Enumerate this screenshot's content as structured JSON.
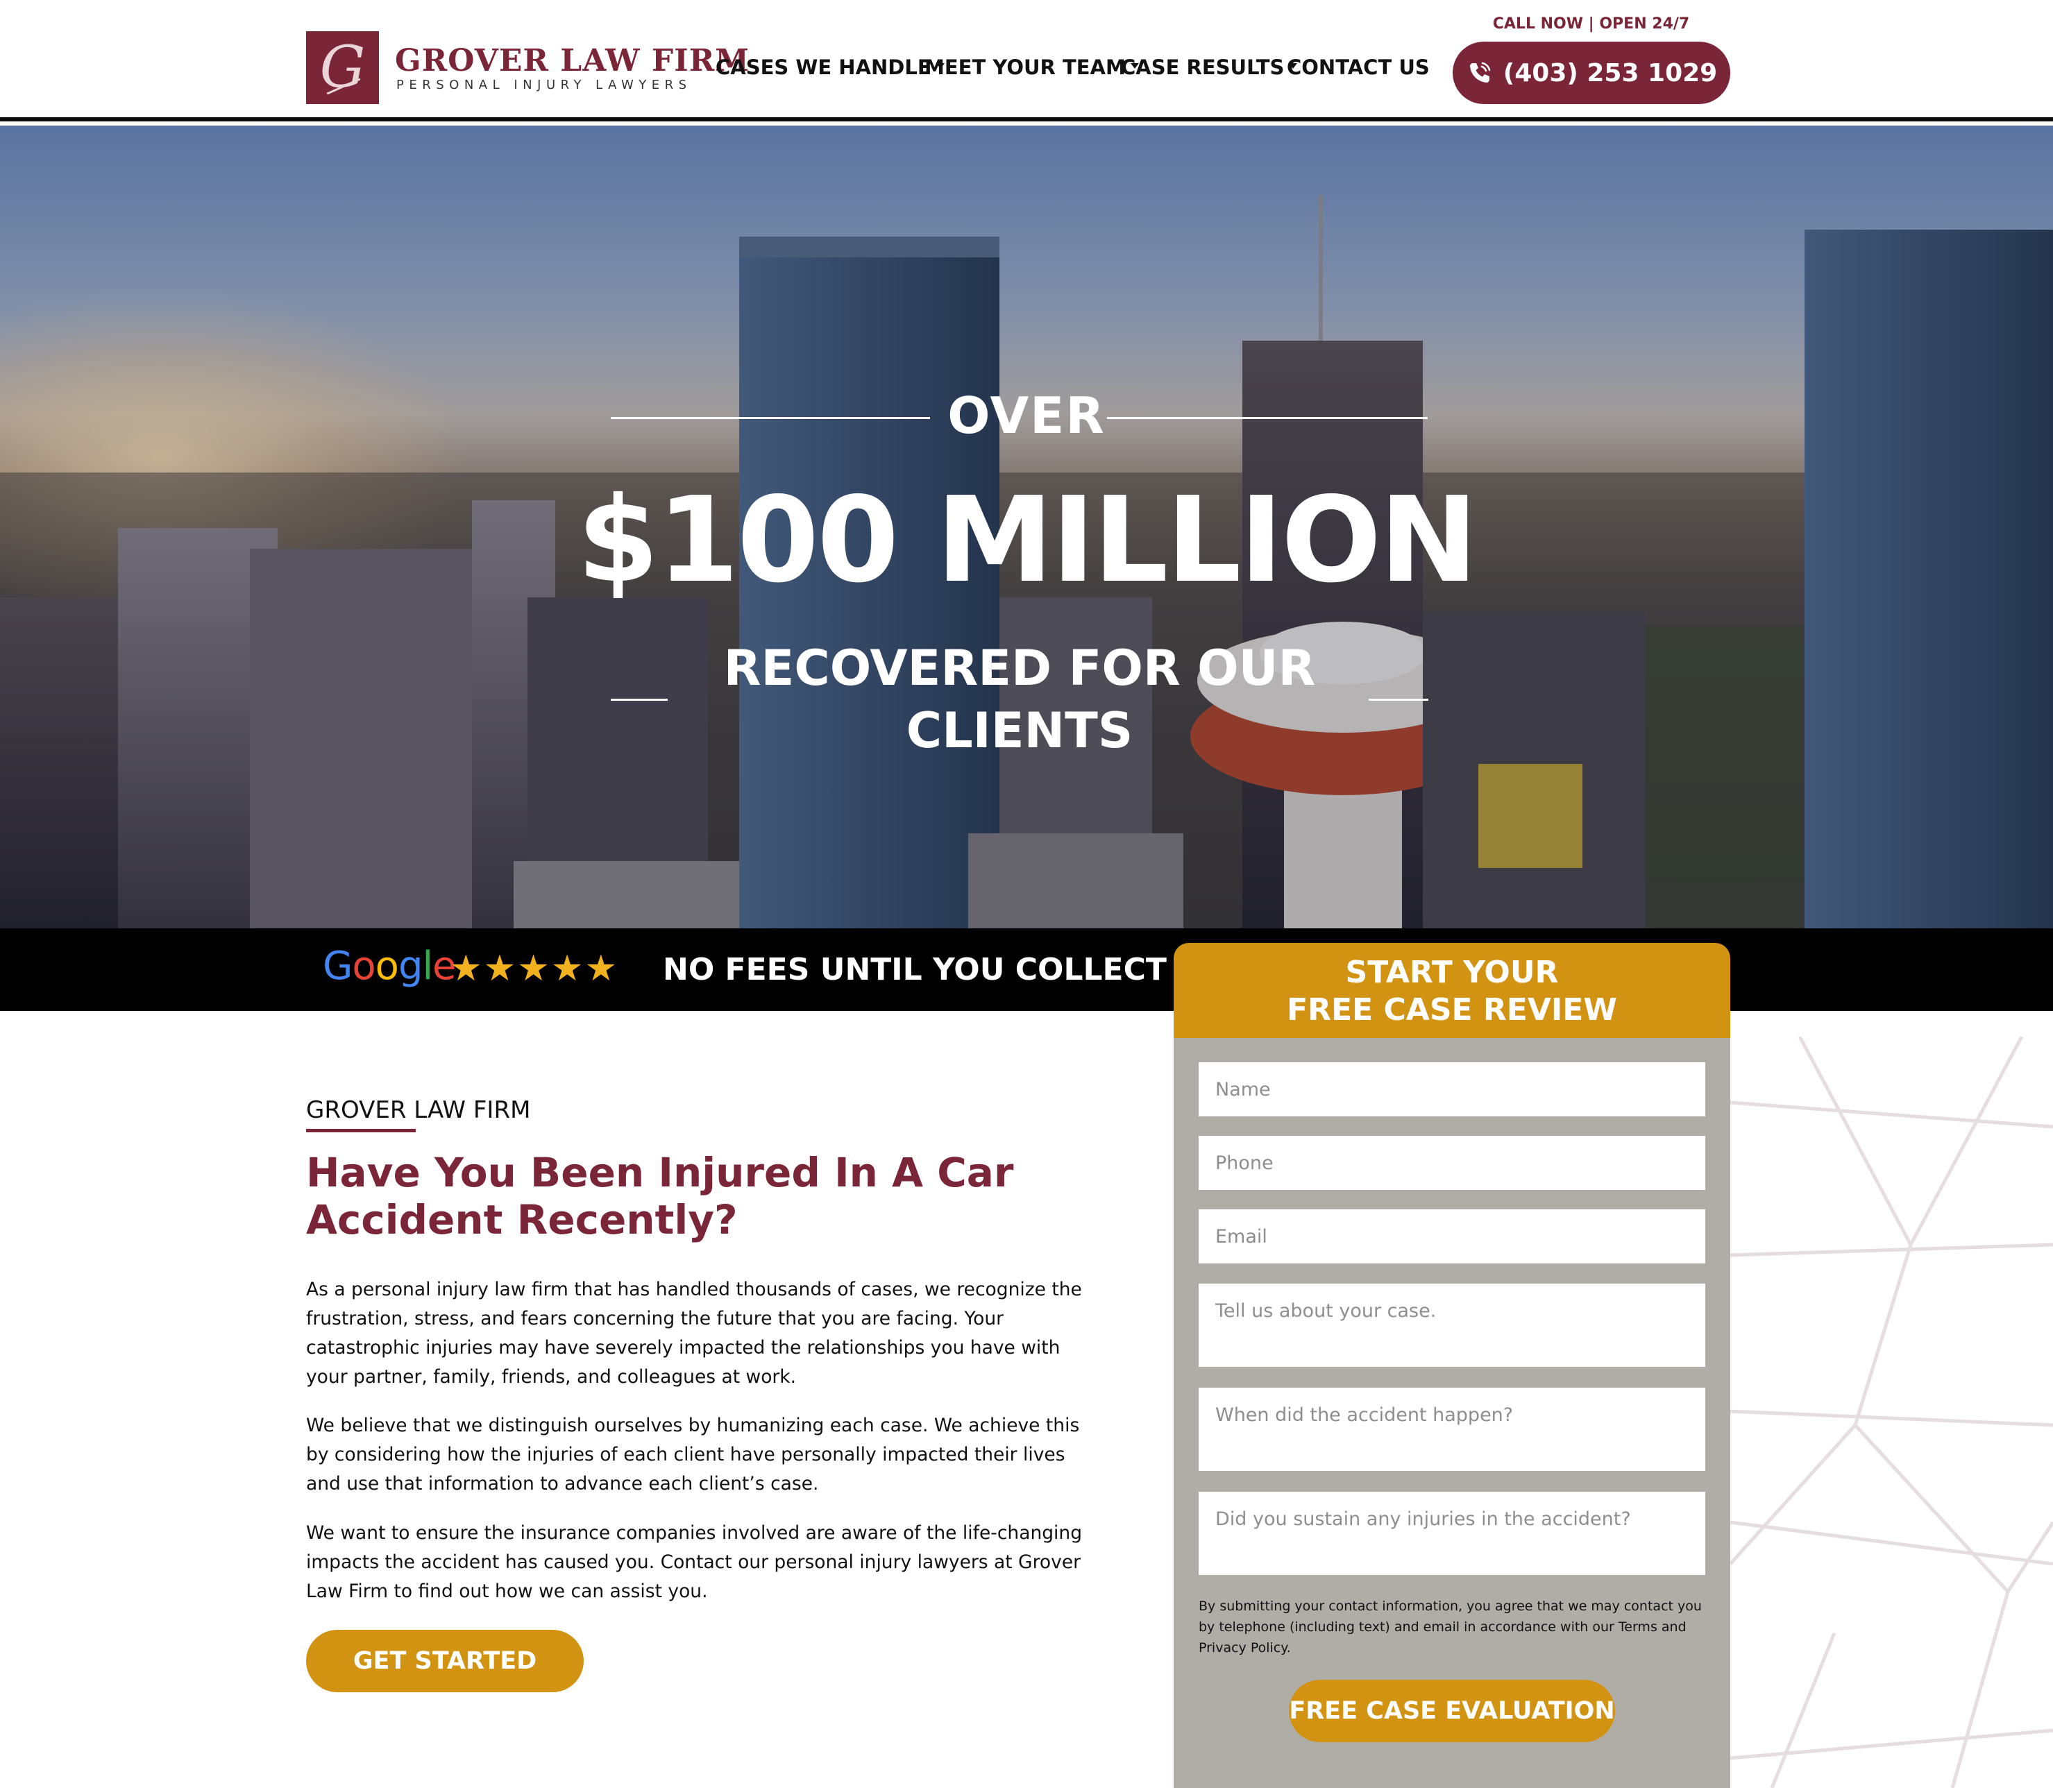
{
  "header": {
    "logo_letter": "G",
    "brand_name": "GROVER LAW FIRM",
    "brand_tagline": "PERSONAL INJURY LAWYERS",
    "nav": [
      {
        "label": "CASES WE HANDLE",
        "dropdown": true
      },
      {
        "label": "MEET YOUR TEAM",
        "dropdown": true
      },
      {
        "label": "CASE RESULTS",
        "dropdown": true
      },
      {
        "label": "CONTACT US",
        "dropdown": false
      }
    ],
    "call_now": "CALL NOW | OPEN 24/7",
    "phone": "(403) 253 1029"
  },
  "hero": {
    "over": "OVER",
    "amount": "$100 MILLION",
    "subtitle": "RECOVERED FOR OUR CLIENTS"
  },
  "strip": {
    "google": "Google",
    "stars": "★★★★★",
    "rating": 5,
    "no_fees": "NO FEES UNTIL YOU COLLECT"
  },
  "form": {
    "title_line1": "START YOUR",
    "title_line2": "FREE CASE REVIEW",
    "name_placeholder": "Name",
    "phone_placeholder": "Phone",
    "email_placeholder": "Email",
    "case_placeholder": "Tell us about your case.",
    "when_placeholder": "When did the accident happen?",
    "injuries_placeholder": "Did you sustain any injuries in the accident?",
    "consent": "By submitting your contact information, you agree that we may contact you by telephone (including text) and email in accordance with our Terms and Privacy Policy.",
    "submit": "FREE CASE EVALUATION"
  },
  "main": {
    "eyebrow": "GROVER LAW FIRM",
    "headline": "Have You Been Injured In A Car Accident Recently?",
    "paragraphs": [
      "As a personal injury law firm that has handled thousands of cases, we recognize the frustration, stress, and fears concerning the future that you are facing. Your catastrophic injuries may have severely impacted the relationships you have with your partner, family, friends, and colleagues at work.",
      "We believe that we distinguish ourselves by humanizing each case. We achieve this by considering how the injuries of each client have personally impacted their lives and use that information to advance each client’s case.",
      "We want to ensure the insurance companies involved are aware of the life-changing impacts the accident has caused you. Contact our personal injury lawyers at Grover Law Firm to find out how we can assist you."
    ],
    "cta": "GET STARTED"
  },
  "colors": {
    "brand_maroon": "#7a2638",
    "accent_gold": "#d29313",
    "form_gray": "#b0ada7",
    "star_gold": "#f2b21f"
  },
  "icons": {
    "phone": "phone-icon",
    "caret": "chevron-down-icon"
  }
}
